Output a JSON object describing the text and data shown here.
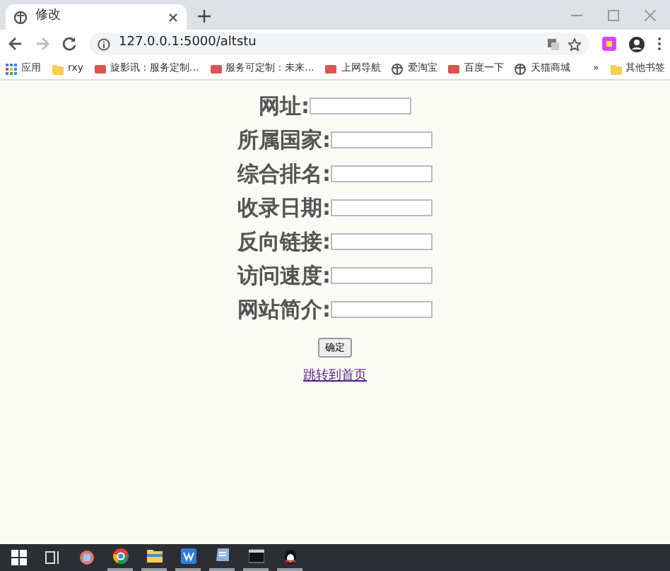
{
  "browser": {
    "tabs": [
      {
        "title": "修改",
        "selected": true
      }
    ],
    "address": "127.0.0.1:5000/altstu",
    "bookmarks": [
      {
        "label": "应用",
        "kind": "apps"
      },
      {
        "label": "rxy",
        "kind": "folder"
      },
      {
        "label": "旋影讯：服务定制...",
        "kind": "site"
      },
      {
        "label": "服务可定制：未来...",
        "kind": "site"
      },
      {
        "label": "上网导航",
        "kind": "site"
      },
      {
        "label": "爱淘宝",
        "kind": "globe"
      },
      {
        "label": "百度一下",
        "kind": "site"
      },
      {
        "label": "天猫商城",
        "kind": "globe"
      }
    ],
    "more_bookmarks": "»",
    "other_bookmarks": "其他书签"
  },
  "form": {
    "fields": [
      {
        "label": "网址:"
      },
      {
        "label": "所属国家:"
      },
      {
        "label": "综合排名:"
      },
      {
        "label": "收录日期:"
      },
      {
        "label": "反向链接:"
      },
      {
        "label": "访问速度:"
      },
      {
        "label": "网站简介:"
      }
    ],
    "submit": "确定",
    "link": "跳转到首页"
  },
  "taskbar": {
    "apps": [
      {
        "kind": "start",
        "active": false
      },
      {
        "kind": "taskview",
        "active": false
      },
      {
        "kind": "tool",
        "active": false
      },
      {
        "kind": "browser",
        "active": true
      },
      {
        "kind": "folder",
        "active": true
      },
      {
        "kind": "office",
        "active": true
      },
      {
        "kind": "notes",
        "active": true
      },
      {
        "kind": "terminal",
        "active": true
      },
      {
        "kind": "chat",
        "active": true
      }
    ]
  }
}
